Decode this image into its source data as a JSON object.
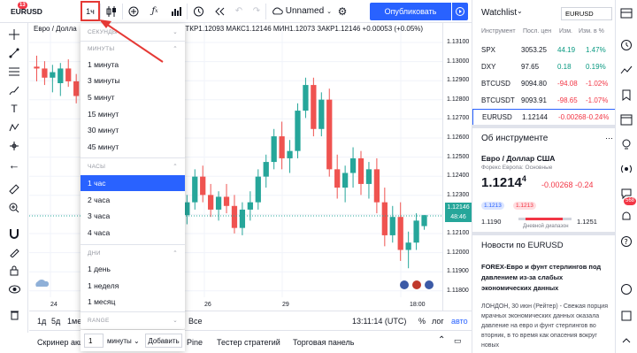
{
  "toolbar": {
    "symbol": "EURUSD",
    "symbol_badge": "13",
    "interval": "1ч",
    "layout_name": "Unnamed",
    "publish_label": "Опубликовать"
  },
  "legend": {
    "name": "Евро / Долла",
    "values": "ОТКР1.12093  МАКС1.12146  МИН1.12073  ЗАКР1.12146  +0.00053 (+0.05%)"
  },
  "dropdown": {
    "sections": [
      {
        "header": "СЕКУНДЫ",
        "items": []
      },
      {
        "header": "МИНУТЫ",
        "items": [
          "1 минута",
          "3 минуты",
          "5 минут",
          "15 минут",
          "30 минут",
          "45 минут"
        ]
      },
      {
        "header": "ЧАСЫ",
        "items": [
          "1 час",
          "2 часа",
          "3 часа",
          "4 часа"
        ]
      },
      {
        "header": "ДНИ",
        "items": [
          "1 день",
          "1 неделя",
          "1 месяц"
        ]
      },
      {
        "header": "RANGE",
        "items": []
      }
    ],
    "selected": "1 час",
    "custom_value": "1",
    "custom_unit": "минуты",
    "add_label": "Добавить"
  },
  "price_scale": {
    "labels": [
      "1.13100",
      "1.13000",
      "1.12900",
      "1.12800",
      "1.12700",
      "1.12600",
      "1.12500",
      "1.12400",
      "1.12300",
      "1.12200",
      "1.12100",
      "1.12000",
      "1.11900",
      "1.11800"
    ],
    "current_price": "1.12146",
    "countdown": "48:46"
  },
  "time_axis": {
    "labels": [
      "24",
      "26",
      "29",
      "18:00"
    ]
  },
  "range_bar": {
    "ranges": [
      "1д",
      "5д",
      "1ме"
    ],
    "all": "Все",
    "clock": "13:11:14 (UTC)",
    "percent": "%",
    "log": "лог",
    "auto": "авто"
  },
  "bottom_tabs": {
    "screener": "Скринер акци",
    "pine": "Pine",
    "tester": "Тестер стратегий",
    "trading": "Торговая панель"
  },
  "watchlist": {
    "title": "Watchlist",
    "search_value": "EURUSD",
    "columns": [
      "Инструмент",
      "Посл. цен",
      "Изм.",
      "Изм. в %"
    ],
    "rows": [
      {
        "symbol": "SPX",
        "last": "3053.25",
        "chg": "44.19",
        "chgp": "1.47%",
        "dir": "pos"
      },
      {
        "symbol": "DXY",
        "last": "97.65",
        "chg": "0.18",
        "chgp": "0.19%",
        "dir": "pos"
      },
      {
        "symbol": "BTCUSD",
        "last": "9094.80",
        "chg": "-94.08",
        "chgp": "-1.02%",
        "dir": "neg"
      },
      {
        "symbol": "BTCUSDT",
        "last": "9093.91",
        "chg": "-98.65",
        "chgp": "-1.07%",
        "dir": "neg"
      },
      {
        "symbol": "EURUSD",
        "last": "1.12144",
        "chg": "-0.00268",
        "chgp": "-0.24%",
        "dir": "neg"
      }
    ]
  },
  "details": {
    "title": "Об инструменте",
    "name": "Евро / Доллар США",
    "subtitle": "Форекс Европа: Основные",
    "price": "1.1214",
    "price_sup": "4",
    "change": "-0.00268 -0.24",
    "bid": "1.1213",
    "ask": "1.1213",
    "range_low": "1.1190",
    "range_high": "1.1251",
    "range_label": "Дневной диапазон"
  },
  "news": {
    "title": "Новости по EURUSD",
    "headline": "FOREX-Евро и фунт стерлингов под давлением из-за слабых экономических данных",
    "source": "ЛОНДОН, 30 июн (Рейтер) - Свежая порция мрачных экономических данных оказала давление на евро и фунт стерлингов во вторник, в то время как опасения вокруг новых"
  },
  "badges": {
    "notifications": "568"
  },
  "colors": {
    "accent": "#2962ff",
    "up": "#26a69a",
    "down": "#ef5350",
    "highlight": "#e53935"
  },
  "chart_data": {
    "type": "candlestick",
    "y_min": 1.1175,
    "y_max": 1.1315,
    "candles": [
      [
        1.1296,
        1.1302,
        1.1288,
        1.1295
      ],
      [
        1.1295,
        1.1299,
        1.1286,
        1.129
      ],
      [
        1.129,
        1.1297,
        1.1282,
        1.1293
      ],
      [
        1.1287,
        1.1298,
        1.128,
        1.1295
      ],
      [
        1.1295,
        1.13,
        1.1285,
        1.1288
      ],
      [
        1.1288,
        1.1292,
        1.1276,
        1.128
      ],
      [
        1.128,
        1.129,
        1.1274,
        1.1286
      ],
      [
        1.1286,
        1.1292,
        1.127,
        1.1272
      ],
      [
        1.1272,
        1.128,
        1.1262,
        1.1276
      ],
      [
        1.123,
        1.1238,
        1.1216,
        1.122
      ],
      [
        1.122,
        1.1233,
        1.1212,
        1.1228
      ],
      [
        1.1228,
        1.1236,
        1.122,
        1.1224
      ],
      [
        1.1224,
        1.123,
        1.1204,
        1.1208
      ],
      [
        1.1208,
        1.123,
        1.1205,
        1.1226
      ],
      [
        1.1226,
        1.1236,
        1.1218,
        1.1232
      ],
      [
        1.1232,
        1.1236,
        1.1214,
        1.1218
      ],
      [
        1.1218,
        1.1226,
        1.121,
        1.1222
      ],
      [
        1.1222,
        1.1234,
        1.1216,
        1.1228
      ],
      [
        1.1228,
        1.1232,
        1.1212,
        1.1215
      ],
      [
        1.1215,
        1.1226,
        1.121,
        1.1222
      ],
      [
        1.1222,
        1.124,
        1.1218,
        1.1236
      ],
      [
        1.1236,
        1.1242,
        1.1222,
        1.1226
      ],
      [
        1.1226,
        1.1232,
        1.1214,
        1.1218
      ],
      [
        1.1218,
        1.1228,
        1.1212,
        1.1225
      ],
      [
        1.1225,
        1.1232,
        1.1216,
        1.122
      ],
      [
        1.122,
        1.1226,
        1.1205,
        1.1208
      ],
      [
        1.1208,
        1.1222,
        1.1204,
        1.1218
      ],
      [
        1.1218,
        1.1228,
        1.1212,
        1.1222
      ],
      [
        1.1222,
        1.124,
        1.1218,
        1.1236
      ],
      [
        1.1236,
        1.1248,
        1.123,
        1.1244
      ],
      [
        1.1244,
        1.1262,
        1.124,
        1.1258
      ],
      [
        1.1258,
        1.1266,
        1.124,
        1.1246
      ],
      [
        1.1246,
        1.1256,
        1.1238,
        1.125
      ],
      [
        1.125,
        1.1276,
        1.1246,
        1.1272
      ],
      [
        1.1272,
        1.129,
        1.1268,
        1.1286
      ],
      [
        1.1286,
        1.129,
        1.1258,
        1.1262
      ],
      [
        1.1262,
        1.1282,
        1.1258,
        1.1278
      ],
      [
        1.1278,
        1.1284,
        1.1236,
        1.124
      ],
      [
        1.124,
        1.1248,
        1.1224,
        1.123
      ],
      [
        1.123,
        1.1242,
        1.1222,
        1.1238
      ],
      [
        1.1238,
        1.1252,
        1.123,
        1.1246
      ],
      [
        1.1246,
        1.125,
        1.1226,
        1.1232
      ],
      [
        1.1232,
        1.1244,
        1.1224,
        1.124
      ],
      [
        1.124,
        1.1246,
        1.1216,
        1.1222
      ],
      [
        1.1222,
        1.123,
        1.1198,
        1.1204
      ],
      [
        1.1204,
        1.122,
        1.12,
        1.1214
      ],
      [
        1.1214,
        1.1222,
        1.119,
        1.1196
      ],
      [
        1.1196,
        1.1206,
        1.1186,
        1.12
      ],
      [
        1.12,
        1.1216,
        1.1196,
        1.1212
      ],
      [
        1.1209,
        1.1215,
        1.1207,
        1.1215
      ]
    ]
  }
}
